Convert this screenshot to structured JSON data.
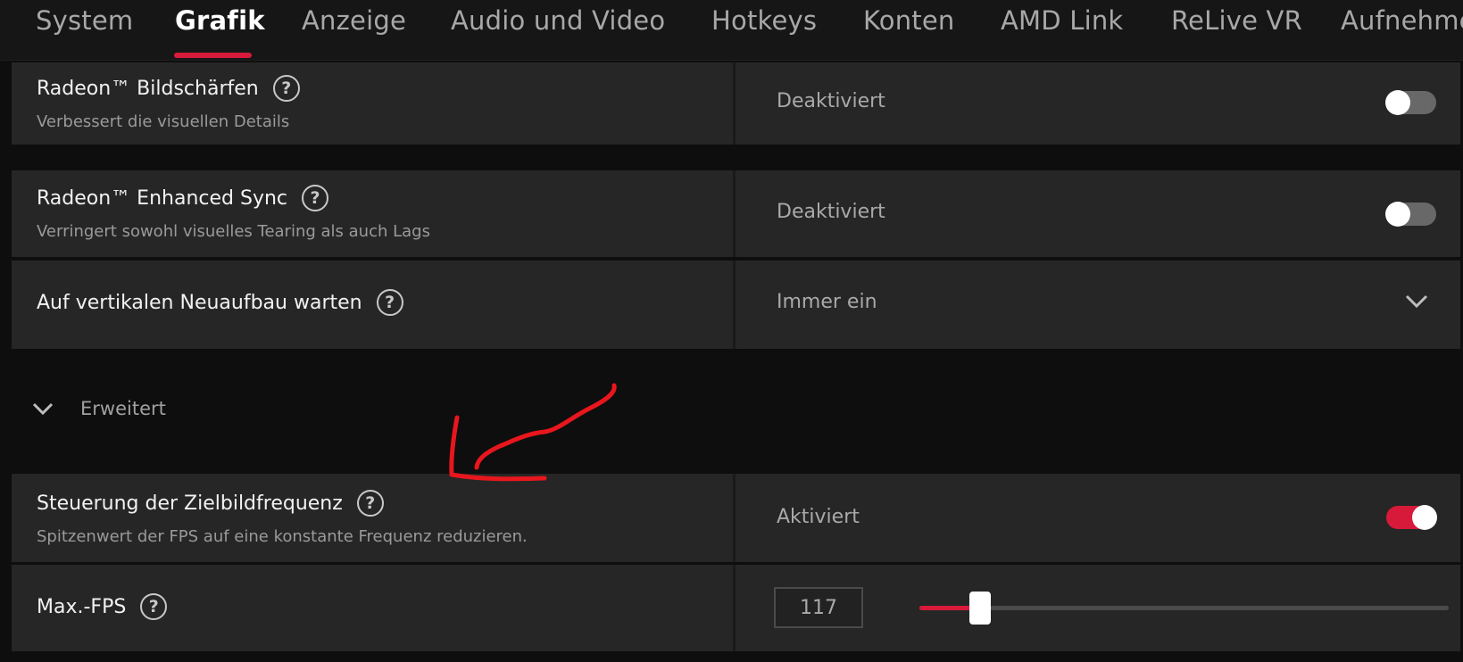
{
  "colors": {
    "accent": "#d71a3a",
    "annotation": "#e8161d"
  },
  "tabs": [
    {
      "label": "System",
      "active": false
    },
    {
      "label": "Grafik",
      "active": true
    },
    {
      "label": "Anzeige",
      "active": false
    },
    {
      "label": "Audio und Video",
      "active": false
    },
    {
      "label": "Hotkeys",
      "active": false
    },
    {
      "label": "Konten",
      "active": false
    },
    {
      "label": "AMD Link",
      "active": false
    },
    {
      "label": "ReLive VR",
      "active": false
    },
    {
      "label": "Aufnehmen",
      "active": false
    }
  ],
  "settings": {
    "sharpening": {
      "title": "Radeon™ Bildschärfen",
      "description": "Verbessert die visuellen Details",
      "value": "Deaktiviert",
      "enabled": false
    },
    "enhanced_sync": {
      "title": "Radeon™ Enhanced Sync",
      "description": "Verringert sowohl visuelles Tearing als auch Lags",
      "value": "Deaktiviert",
      "enabled": false
    },
    "vsync": {
      "title": "Auf vertikalen Neuaufbau warten",
      "value": "Immer ein"
    },
    "advanced_label": "Erweitert",
    "frtc": {
      "title": "Steuerung der Zielbildfrequenz",
      "description": "Spitzenwert der FPS auf eine konstante Frequenz reduzieren.",
      "value": "Aktiviert",
      "enabled": true
    },
    "max_fps": {
      "title": "Max.-FPS",
      "value": "117",
      "slider_fraction": 0.115
    }
  },
  "icons": {
    "help": "?",
    "help_name": "question-circle-icon",
    "chevron_name": "chevron-down-icon"
  }
}
